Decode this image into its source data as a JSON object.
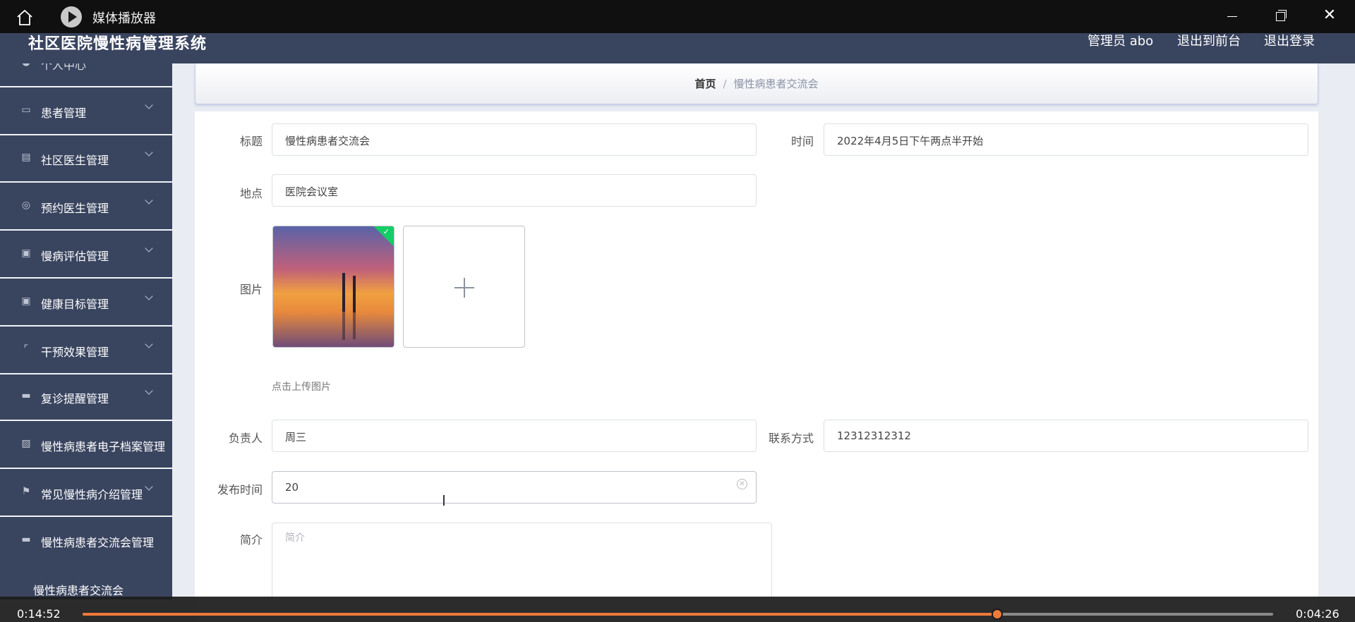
{
  "player": {
    "title": "媒体播放器",
    "elapsed": "0:14:52",
    "remaining": "0:04:26",
    "progress": 0.768,
    "accent": "#ef7a3a"
  },
  "header": {
    "brand": "社区医院慢性病管理系统",
    "admin": "管理员 abo",
    "front": "退出到前台",
    "logout": "退出登录",
    "bg": "#39445f"
  },
  "sidebar": {
    "items": [
      {
        "label": "个人中心",
        "icon": "person-icon"
      },
      {
        "label": "患者管理",
        "icon": "chat-icon"
      },
      {
        "label": "社区医生管理",
        "icon": "clipboard-icon"
      },
      {
        "label": "预约医生管理",
        "icon": "compass-icon"
      },
      {
        "label": "慢病评估管理",
        "icon": "clipboard-x-icon"
      },
      {
        "label": "健康目标管理",
        "icon": "clipboard-check-icon"
      },
      {
        "label": "干预效果管理",
        "icon": "scan-icon"
      },
      {
        "label": "复诊提醒管理",
        "icon": "ticket-icon"
      },
      {
        "label": "慢性病患者电子档案管理",
        "icon": "chart-icon"
      },
      {
        "label": "常见慢性病介绍管理",
        "icon": "flag-icon"
      },
      {
        "label": "慢性病患者交流会管理",
        "icon": "message-icon"
      }
    ],
    "sub_item": "慢性病患者交流会"
  },
  "breadcrumb": {
    "home": "首页",
    "separator": "/",
    "current": "慢性病患者交流会"
  },
  "form": {
    "title_label": "标题",
    "title_value": "慢性病患者交流会",
    "time_label": "时间",
    "time_value": "2022年4月5日下午两点半开始",
    "place_label": "地点",
    "place_value": "医院会议室",
    "image_label": "图片",
    "upload_hint": "点击上传图片",
    "owner_label": "负责人",
    "owner_value": "周三",
    "contact_label": "联系方式",
    "contact_value": "12312312312",
    "publish_label": "发布时间",
    "publish_value": "20",
    "intro_label": "简介",
    "intro_placeholder": "简介"
  }
}
